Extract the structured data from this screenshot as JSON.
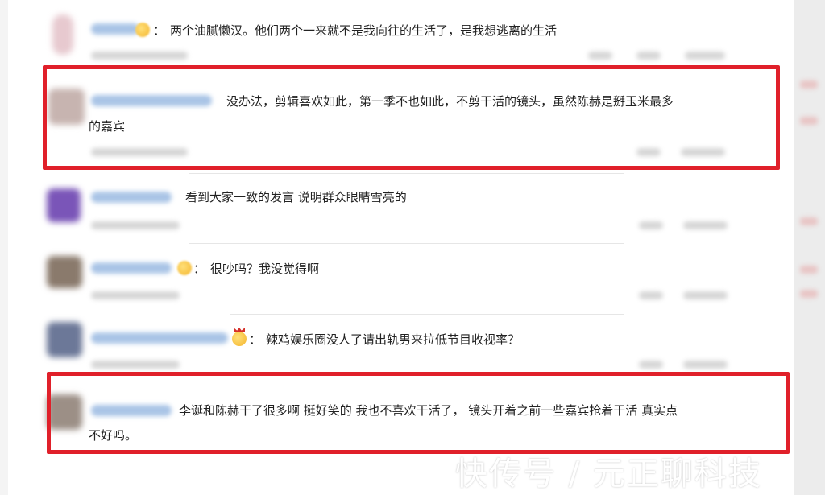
{
  "comments": [
    {
      "separator": "：",
      "text": "两个油腻懒汉。他们两个一来就不是我向往的生活了，是我想逃离的生活"
    },
    {
      "text_line1": "没办法，剪辑喜欢如此，第一季不也如此，不剪干活的镜头，虽然陈赫是掰玉米最多",
      "text_line2": "的嘉宾"
    },
    {
      "text": "看到大家一致的发言 说明群众眼睛雪亮的"
    },
    {
      "separator": "：",
      "text": "很吵吗？我没觉得啊"
    },
    {
      "separator": "：",
      "text": "辣鸡娱乐圈没人了请出轨男来拉低节目收视率？"
    },
    {
      "text_line1": "李诞和陈赫干了很多啊 挺好笑的 我也不喜欢干活了， 镜头开着之前一些嘉宾抢着干活 真实点",
      "text_line2": "不好吗。"
    }
  ],
  "watermark": "快传号 / 元正聊科技",
  "colors": {
    "highlight": "#e0202a",
    "name_link": "#a9c4e6"
  }
}
